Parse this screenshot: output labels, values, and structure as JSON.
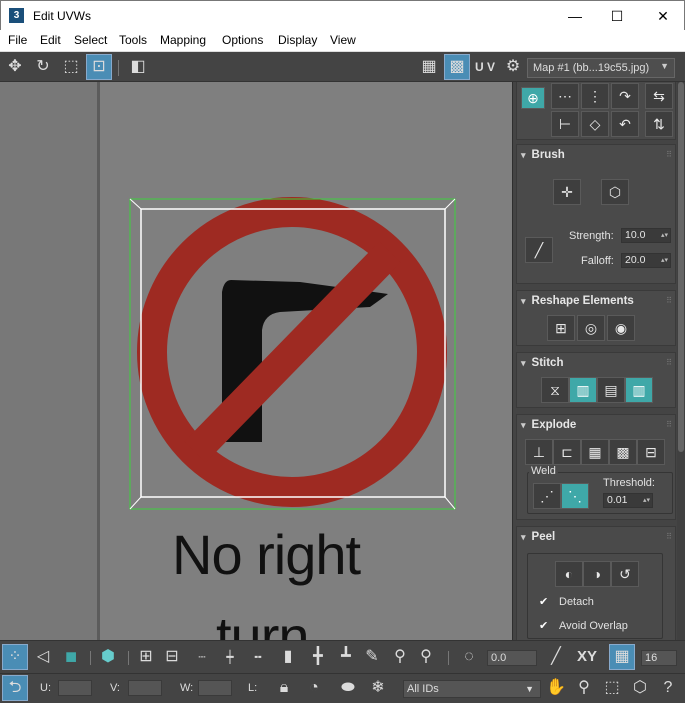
{
  "window": {
    "title": "Edit UVWs",
    "icon_text": "3",
    "minimize": "—",
    "maximize": "☐",
    "close": "✕"
  },
  "menu": [
    "File",
    "Edit",
    "Select",
    "Tools",
    "Mapping",
    "Options",
    "Display",
    "View"
  ],
  "toolbar": {
    "uv_label": "U V",
    "map_select": "Map #1 (bb...19c55.jpg)"
  },
  "viewport": {
    "sign_line1": "No right",
    "sign_line2": "turn"
  },
  "panel": {
    "brush": {
      "title": "Brush",
      "strength_label": "Strength:",
      "strength_value": "10.0",
      "falloff_label": "Falloff:",
      "falloff_value": "20.0"
    },
    "reshape": {
      "title": "Reshape Elements"
    },
    "stitch": {
      "title": "Stitch"
    },
    "explode": {
      "title": "Explode",
      "weld_label": "Weld",
      "threshold_label": "Threshold:",
      "threshold_value": "0.01"
    },
    "peel": {
      "title": "Peel",
      "detach_label": "Detach",
      "avoid_overlap_label": "Avoid Overlap"
    }
  },
  "bottom": {
    "angle_value": "0.0",
    "xy_label": "XY",
    "pixel_value": "16",
    "u_label": "U:",
    "v_label": "V:",
    "w_label": "W:",
    "l_label": "L:",
    "ids_select": "All IDs"
  },
  "colors": {
    "accent": "#4a8db5",
    "teal": "#3fa8a8",
    "selection": "#3cd23c",
    "sign_red": "#9e2a22"
  }
}
